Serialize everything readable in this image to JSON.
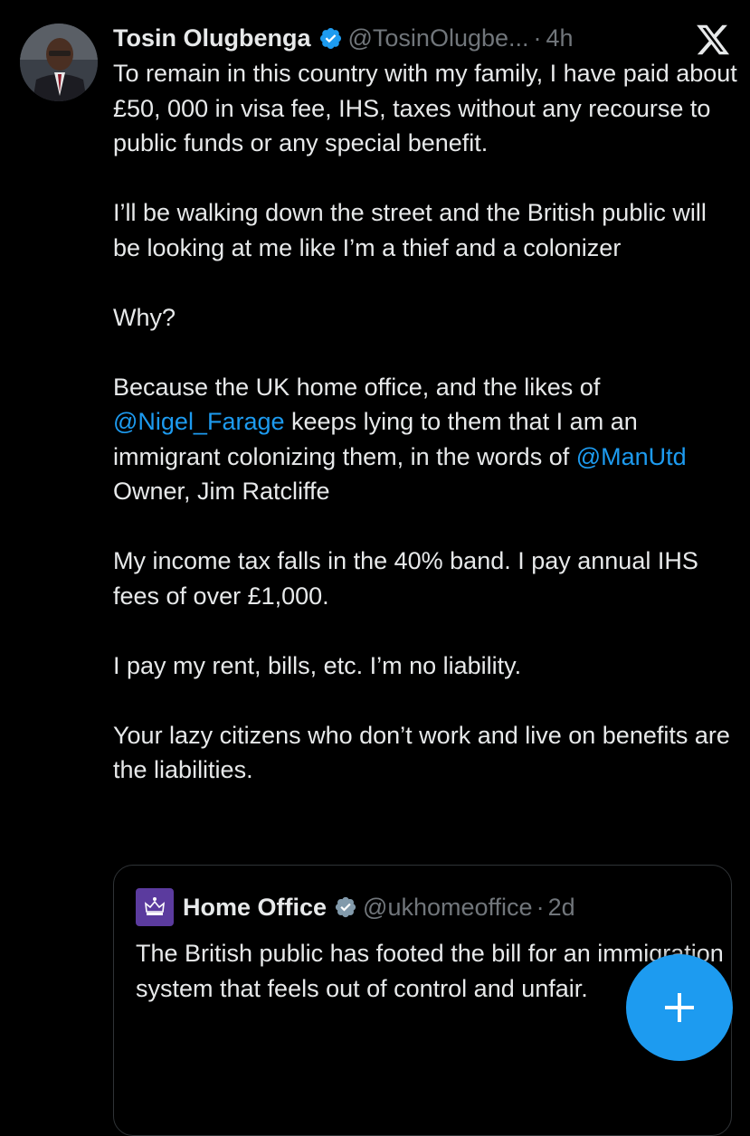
{
  "app": {
    "logo_icon": "x-logo-icon"
  },
  "tweet": {
    "author": {
      "display_name": "Tosin Olugbenga",
      "handle": "@TosinOlugbe...",
      "verified": true,
      "avatar": "profile-photo"
    },
    "separator": "·",
    "time": "4h",
    "paragraphs": [
      "To remain in this country with my family, I have paid about £50, 000 in visa fee, IHS, taxes without any recourse to public funds or any special benefit.",
      "I’ll be walking down the street and the British public will be looking at me like I’m a thief and a colonizer",
      "Why?",
      {
        "p1": "Because the UK home office, and the likes of ",
        "mention1": "@Nigel_Farage",
        "p2": " keeps lying to them that I am an immigrant colonizing them, in the words of ",
        "mention2": "@ManUtd",
        "p3": " Owner, Jim Ratcliffe"
      },
      "My income tax falls in the 40% band. I pay annual IHS fees of over £1,000.",
      "I pay my rent, bills, etc. I’m no liability.",
      "Your lazy citizens who don’t work and live on benefits are the liabilities."
    ],
    "mention_color": "#1d9bf0"
  },
  "quote": {
    "author": {
      "display_name": "Home Office",
      "handle": "@ukhomeoffice",
      "verified": true,
      "avatar": "crown-logo"
    },
    "separator": "·",
    "time": "2d",
    "text": "The British public has footed the bill for an immigration system that feels out of control and unfair."
  },
  "compose_button": {
    "icon": "plus-icon",
    "color": "#1d9bf0"
  }
}
